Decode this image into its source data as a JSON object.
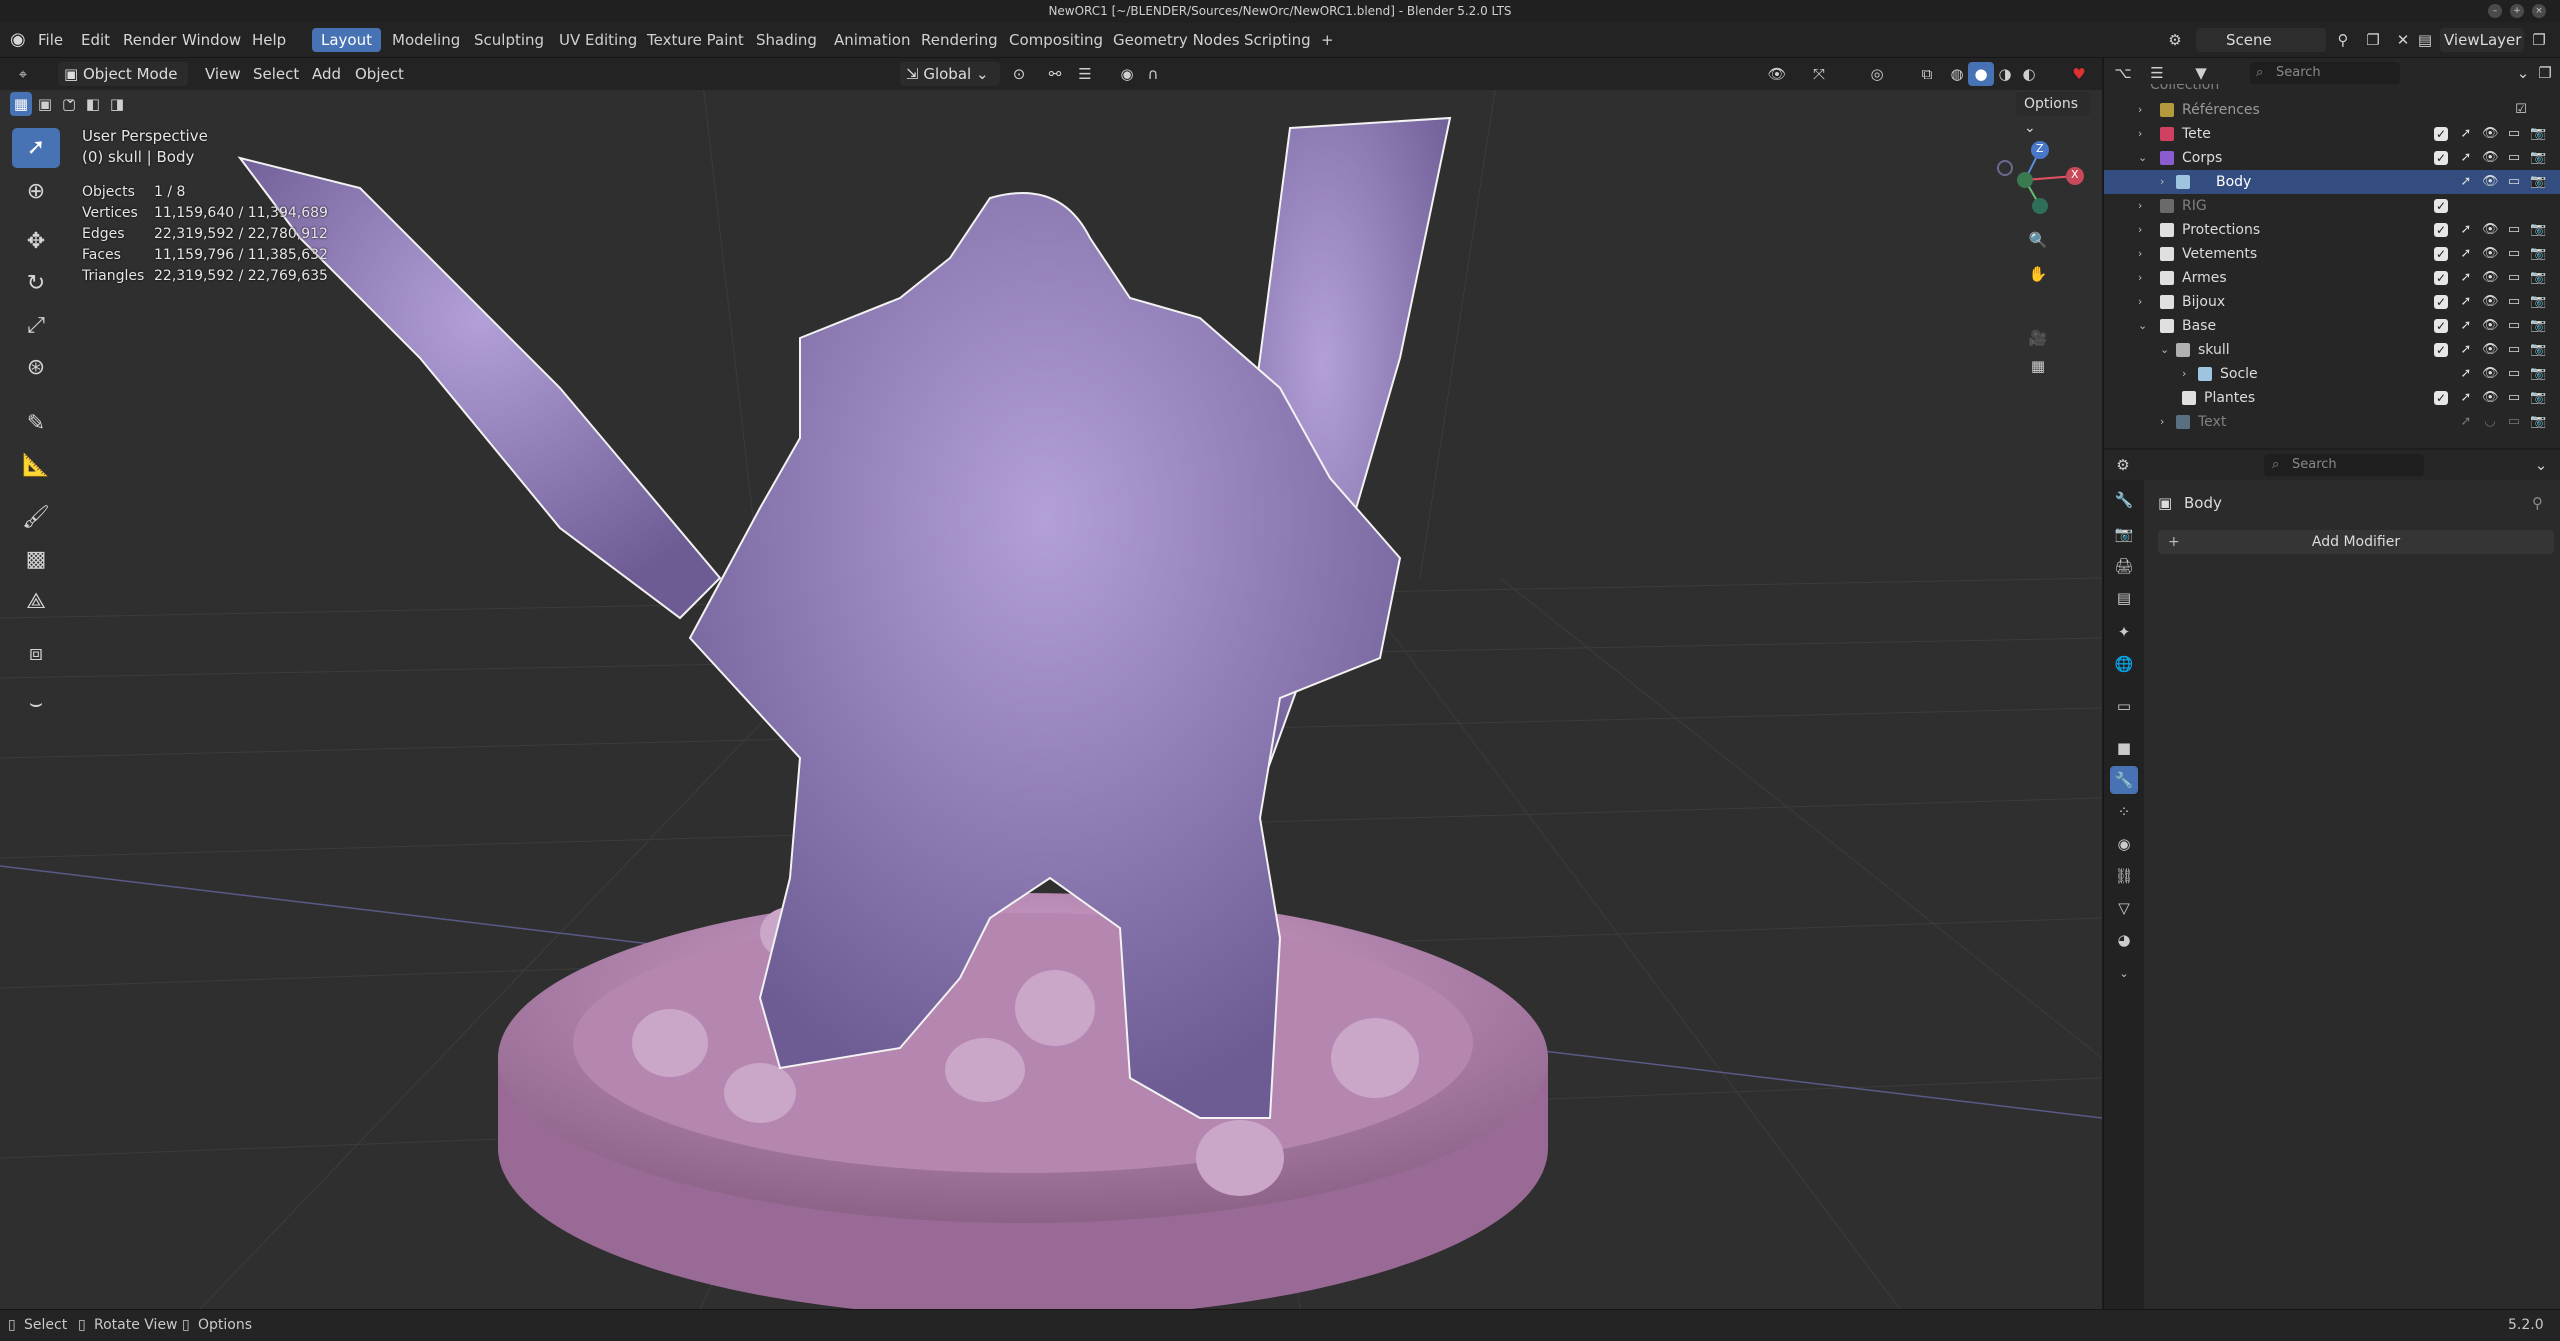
{
  "title": "NewORC1 [~/BLENDER/Sources/NewOrc/NewORC1.blend] - Blender 5.2.0 LTS",
  "menus": [
    "File",
    "Edit",
    "Render",
    "Window",
    "Help"
  ],
  "workspaces": [
    "Layout",
    "Modeling",
    "Sculpting",
    "UV Editing",
    "Texture Paint",
    "Shading",
    "Animation",
    "Rendering",
    "Compositing",
    "Geometry Nodes",
    "Scripting"
  ],
  "active_workspace": "Layout",
  "scene": {
    "label": "Scene"
  },
  "view_layer": {
    "label": "ViewLayer"
  },
  "viewport": {
    "mode": "Object Mode",
    "menus": [
      "View",
      "Select",
      "Add",
      "Object"
    ],
    "orientation": "Global",
    "options_label": "Options",
    "perspective": "User Perspective",
    "context": "(0) skull | Body",
    "stats": [
      {
        "label": "Objects",
        "value": "1 / 8"
      },
      {
        "label": "Vertices",
        "value": "11,159,640 / 11,394,689"
      },
      {
        "label": "Edges",
        "value": "22,319,592 / 22,780,912"
      },
      {
        "label": "Faces",
        "value": "11,159,796 / 11,385,632"
      },
      {
        "label": "Triangles",
        "value": "22,319,592 / 22,769,635"
      }
    ],
    "gizmo": {
      "z": "Z",
      "x": "X"
    }
  },
  "outliner": {
    "search_placeholder": "Search",
    "rows": [
      {
        "name": "Collection",
        "color": "#b39a3c"
      },
      {
        "name": "Références",
        "color": "#b39a3c"
      },
      {
        "name": "Tete",
        "color": "#d04060"
      },
      {
        "name": "Corps",
        "color": "#8a5cd0"
      },
      {
        "name": "Body",
        "color": "#9fc4e0"
      },
      {
        "name": "RIG",
        "color": "#b0b0b0"
      },
      {
        "name": "Protections",
        "color": "#d08030"
      },
      {
        "name": "Vetements",
        "color": "#d0b040"
      },
      {
        "name": "Armes",
        "color": "#e0e0e0"
      },
      {
        "name": "Bijoux",
        "color": "#e0e0e0"
      },
      {
        "name": "Base",
        "color": "#e0e0e0"
      },
      {
        "name": "skull",
        "color": "#b0b0b0"
      },
      {
        "name": "Socle",
        "color": "#9fc4e0"
      },
      {
        "name": "Plantes",
        "color": "#e0e0e0"
      },
      {
        "name": "Text",
        "color": "#9fc4e0"
      }
    ]
  },
  "properties": {
    "search_placeholder": "Search",
    "object_name": "Body",
    "add_modifier_label": "Add Modifier"
  },
  "status": {
    "select": "Select",
    "rotate": "Rotate View",
    "options": "Options",
    "version": "5.2.0"
  },
  "colors": {
    "accent": "#4772b3",
    "mesh": "#9b86c4",
    "base": "#c99bc6"
  }
}
